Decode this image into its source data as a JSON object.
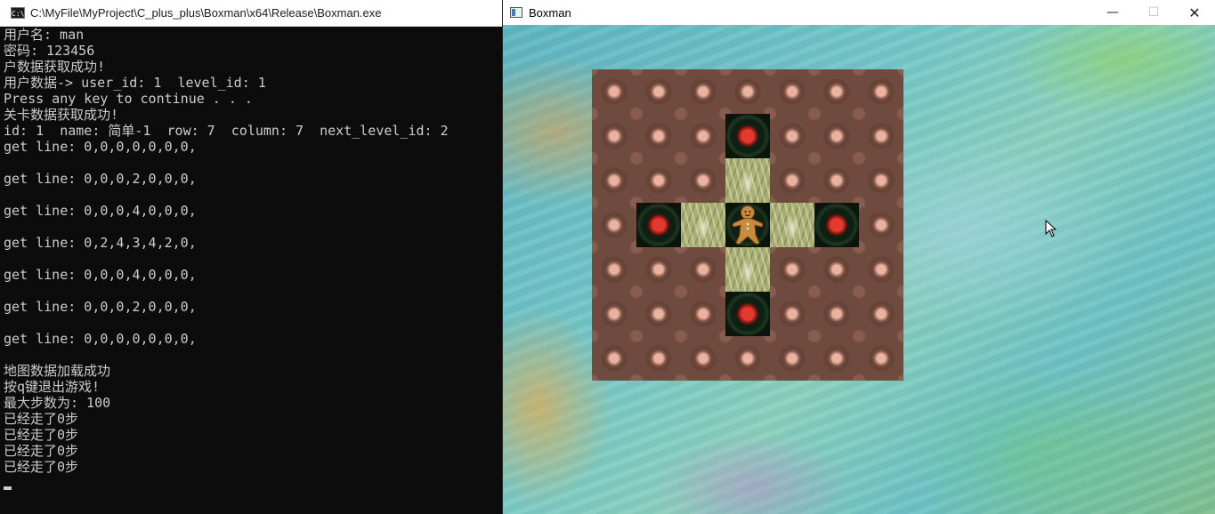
{
  "console": {
    "title": "C:\\MyFile\\MyProject\\C_plus_plus\\Boxman\\x64\\Release\\Boxman.exe",
    "icon": "cmd-icon",
    "lines": [
      "用户名: man",
      "密码: 123456",
      "户数据获取成功!",
      "用户数据-> user_id: 1  level_id: 1",
      "Press any key to continue . . .",
      "关卡数据获取成功!",
      "id: 1  name: 简单-1  row: 7  column: 7  next_level_id: 2",
      "get line: 0,0,0,0,0,0,0,",
      "",
      "get line: 0,0,0,2,0,0,0,",
      "",
      "get line: 0,0,0,4,0,0,0,",
      "",
      "get line: 0,2,4,3,4,2,0,",
      "",
      "get line: 0,0,0,4,0,0,0,",
      "",
      "get line: 0,0,0,2,0,0,0,",
      "",
      "get line: 0,0,0,0,0,0,0,",
      "",
      "地图数据加载成功",
      "按q键退出游戏!",
      "最大步数为: 100",
      "已经走了0步",
      "已经走了0步",
      "已经走了0步",
      "已经走了0步"
    ]
  },
  "game": {
    "title": "Boxman",
    "icon": "app-window-icon",
    "controls": {
      "minimize": "—",
      "maximize": "☐",
      "close": "✕"
    },
    "map": [
      [
        0,
        0,
        0,
        0,
        0,
        0,
        0
      ],
      [
        0,
        0,
        0,
        2,
        0,
        0,
        0
      ],
      [
        0,
        0,
        0,
        4,
        0,
        0,
        0
      ],
      [
        0,
        2,
        4,
        3,
        4,
        2,
        0
      ],
      [
        0,
        0,
        0,
        4,
        0,
        0,
        0
      ],
      [
        0,
        0,
        0,
        2,
        0,
        0,
        0
      ],
      [
        0,
        0,
        0,
        0,
        0,
        0,
        0
      ]
    ]
  }
}
